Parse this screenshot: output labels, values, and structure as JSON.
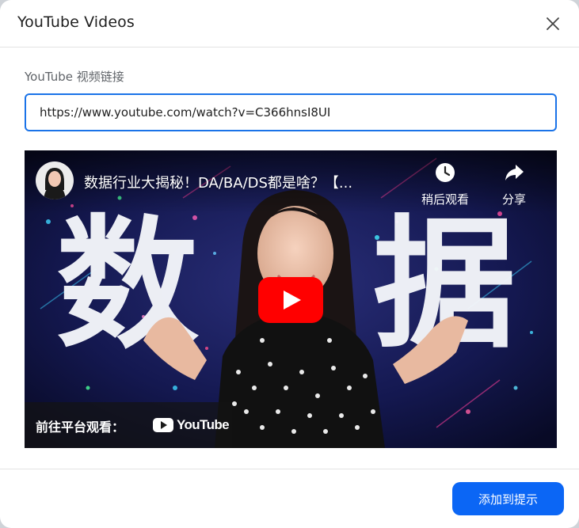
{
  "dialog": {
    "title": "YouTube Videos",
    "close_icon": "close-icon"
  },
  "form": {
    "label": "YouTube 视频链接",
    "url_value": "https://www.youtube.com/watch?v=C366hnsI8UI"
  },
  "player": {
    "video_title": "数据行业大揭秘！DA/BA/DS都是啥？【...",
    "thumbnail_left_char": "数",
    "thumbnail_right_char": "据",
    "watch_later_label": "稍后观看",
    "watch_later_icon": "clock-icon",
    "share_label": "分享",
    "share_icon": "share-arrow-icon",
    "play_icon": "youtube-play-icon",
    "watch_on_label": "前往平台观看：",
    "youtube_wordmark": "YouTube"
  },
  "footer": {
    "submit_label": "添加到提示"
  },
  "colors": {
    "accent": "#1a73e8",
    "primary_button": "#0b66f5",
    "youtube_red": "#ff0000"
  }
}
